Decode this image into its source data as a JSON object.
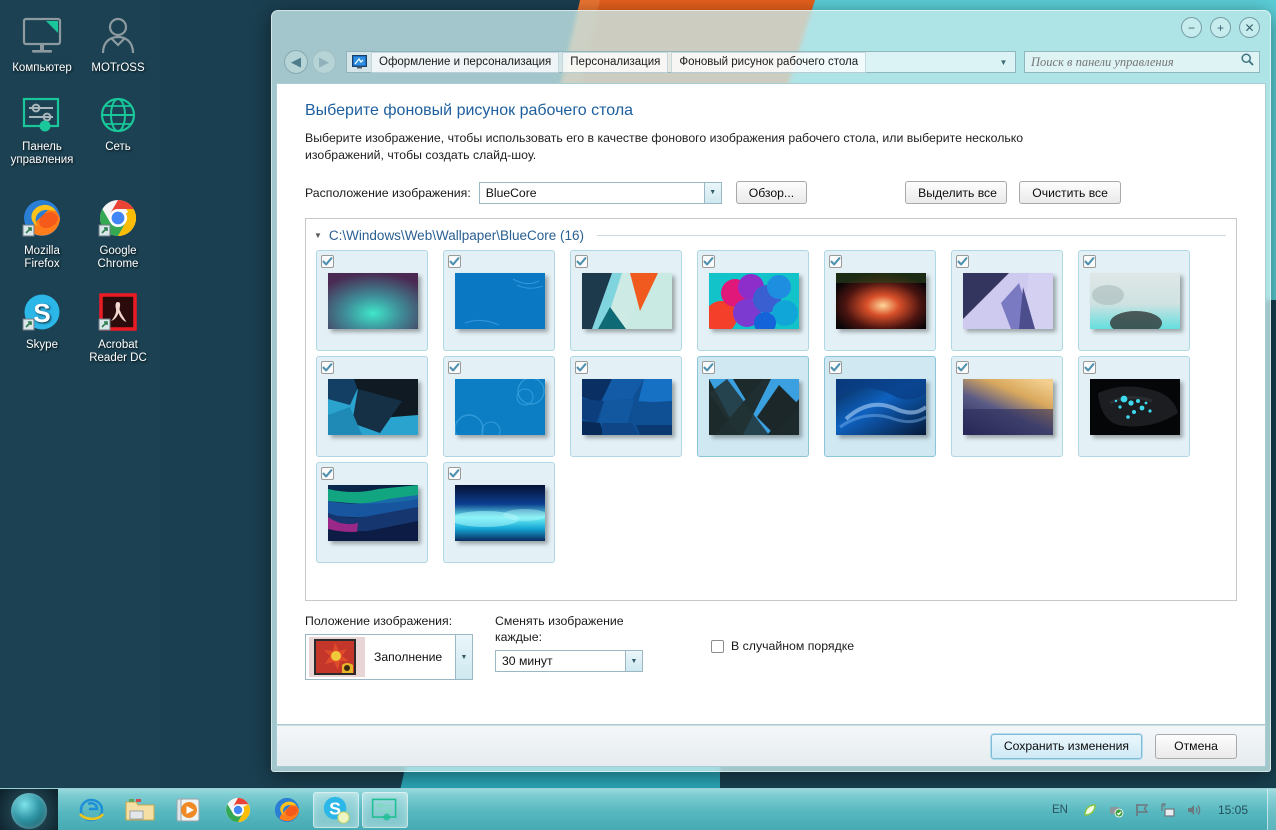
{
  "desktop": {
    "icons": [
      {
        "label": "Компьютер",
        "icon": "computer-icon"
      },
      {
        "label": "MOTrOSS",
        "icon": "user-icon"
      },
      {
        "label": "Панель управления",
        "icon": "control-panel-icon"
      },
      {
        "label": "Сеть",
        "icon": "network-globe-icon"
      },
      {
        "label": "Mozilla Firefox",
        "icon": "firefox-icon"
      },
      {
        "label": "Google Chrome",
        "icon": "chrome-icon"
      },
      {
        "label": "Skype",
        "icon": "skype-icon"
      },
      {
        "label": "Acrobat Reader DC",
        "icon": "acrobat-reader-icon"
      }
    ]
  },
  "window": {
    "controls": {
      "minimize": "−",
      "maximize": "+",
      "close": "✕"
    },
    "nav": {
      "back": "◀",
      "forward": "▶"
    },
    "breadcrumbs": [
      "Оформление и персонализация",
      "Персонализация",
      "Фоновый рисунок рабочего стола"
    ],
    "search": {
      "placeholder": "Поиск в панели управления",
      "value": ""
    }
  },
  "page": {
    "heading": "Выберите фоновый рисунок рабочего стола",
    "description": "Выберите изображение, чтобы использовать его в качестве фонового изображения рабочего стола, или выберите несколько изображений, чтобы создать слайд-шоу.",
    "location_label": "Расположение изображения:",
    "location_value": "BlueCore",
    "browse_button": "Обзор...",
    "select_all_button": "Выделить все",
    "clear_all_button": "Очистить все",
    "group_header": "C:\\Windows\\Web\\Wallpaper\\BlueCore (16)",
    "position_label": "Положение изображения:",
    "position_value": "Заполнение",
    "interval_label": "Сменять изображение каждые:",
    "interval_value": "30 минут",
    "shuffle_label": "В случайном порядке",
    "shuffle_checked": false,
    "thumbnails": [
      {
        "name": "wallpaper-1",
        "checked": true,
        "selected": false
      },
      {
        "name": "wallpaper-2",
        "checked": true,
        "selected": false
      },
      {
        "name": "wallpaper-3",
        "checked": true,
        "selected": false
      },
      {
        "name": "wallpaper-4",
        "checked": true,
        "selected": false
      },
      {
        "name": "wallpaper-5",
        "checked": true,
        "selected": false
      },
      {
        "name": "wallpaper-6",
        "checked": true,
        "selected": false
      },
      {
        "name": "wallpaper-7",
        "checked": true,
        "selected": false
      },
      {
        "name": "wallpaper-8",
        "checked": true,
        "selected": false
      },
      {
        "name": "wallpaper-9",
        "checked": true,
        "selected": false
      },
      {
        "name": "wallpaper-10",
        "checked": true,
        "selected": false
      },
      {
        "name": "wallpaper-11",
        "checked": true,
        "selected": true
      },
      {
        "name": "wallpaper-12",
        "checked": true,
        "selected": true
      },
      {
        "name": "wallpaper-13",
        "checked": true,
        "selected": false
      },
      {
        "name": "wallpaper-14",
        "checked": true,
        "selected": false
      },
      {
        "name": "wallpaper-15",
        "checked": true,
        "selected": false
      },
      {
        "name": "wallpaper-16",
        "checked": true,
        "selected": false
      }
    ]
  },
  "footer": {
    "save_button": "Сохранить изменения",
    "cancel_button": "Отмена"
  },
  "taskbar": {
    "items": [
      {
        "name": "internet-explorer",
        "active": false
      },
      {
        "name": "file-explorer",
        "active": false
      },
      {
        "name": "media-player",
        "active": false
      },
      {
        "name": "google-chrome",
        "active": false
      },
      {
        "name": "mozilla-firefox",
        "active": false
      },
      {
        "name": "skype",
        "active": true
      },
      {
        "name": "control-panel",
        "active": true
      }
    ],
    "language": "EN",
    "tray_icons": [
      "leaf-icon",
      "usb-safe-remove-icon",
      "flag-action-center-icon",
      "network-icon",
      "volume-icon"
    ],
    "clock": "15:05"
  },
  "colors": {
    "accent_teal": "#2aa8b8",
    "accent_orange": "#e8611d",
    "heading_blue": "#1d5f9e",
    "desktop_dark": "#1b4152"
  }
}
